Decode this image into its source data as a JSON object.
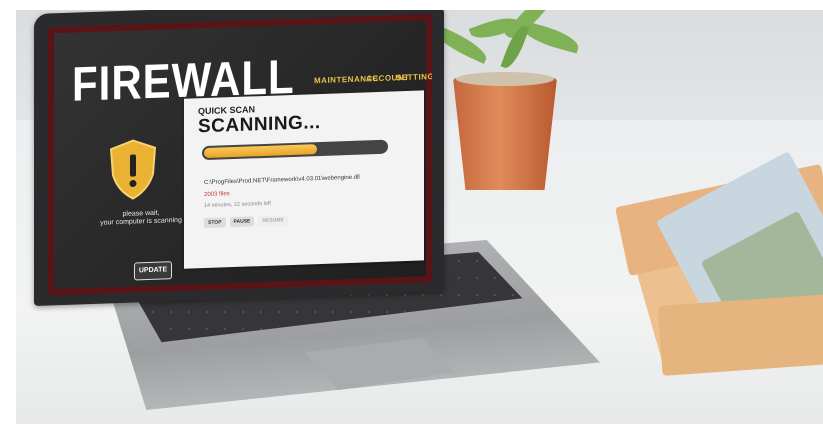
{
  "app": {
    "brand": "FIREWALL",
    "nav": [
      "MAINTENANCE",
      "ACCOUNT",
      "SETTING"
    ]
  },
  "status": {
    "message_line1": "please wait,",
    "message_line2": "your computer is scanning",
    "update_label": "UPDATE"
  },
  "scan": {
    "mode": "QUICK SCAN",
    "title": "SCANNING...",
    "progress": 0.62,
    "path": "C:\\ProgFiles\\Prod.NET\\Framework\\v4.03.01\\webengine.dll",
    "files": "2003 files",
    "time": "14 minutes, 22 seconds left",
    "buttons": [
      "STOP",
      "PAUSE",
      "RESUME"
    ]
  },
  "colors": {
    "accent": "#e6c24a",
    "alert": "#c0392b",
    "screen_border": "#5a1418"
  }
}
